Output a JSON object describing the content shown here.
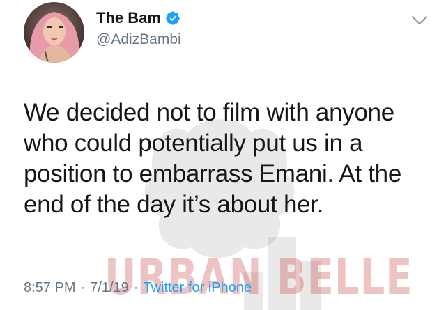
{
  "author": {
    "display_name": "The Bam",
    "handle": "@AdizBambi",
    "verified": true,
    "avatar_icon": "profile-photo"
  },
  "tweet": {
    "lines": [
      "We decided not to film with anyone",
      "who could potentially put us in a",
      "position to embarrass Emani. At the",
      "end of the day it’s about her."
    ],
    "time": "8:57 PM",
    "date": "7/1/19",
    "separator": "·",
    "source": "Twitter for iPhone"
  },
  "watermark": {
    "text": "URBAN BELLE"
  },
  "colors": {
    "text": "#14171a",
    "secondary": "#657786",
    "link": "#1da1f2",
    "verified": "#1da1f2",
    "watermark": "#be2828"
  },
  "icons": {
    "verified": "verified-badge-icon",
    "menu": "chevron-down-icon"
  }
}
